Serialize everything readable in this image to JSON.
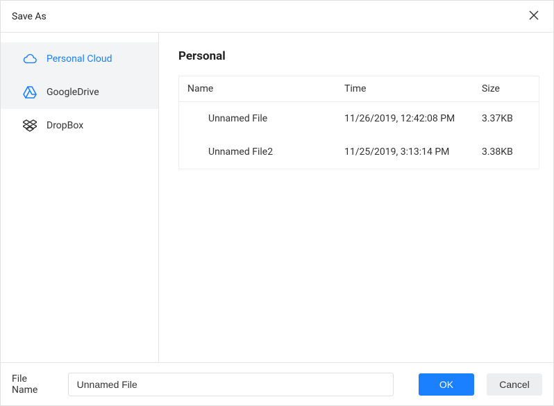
{
  "dialog": {
    "title": "Save As"
  },
  "sidebar": {
    "items": [
      {
        "label": "Personal Cloud",
        "icon": "cloud-icon",
        "active": true
      },
      {
        "label": "GoogleDrive",
        "icon": "google-drive-icon",
        "active": false
      },
      {
        "label": "DropBox",
        "icon": "dropbox-icon",
        "active": false
      }
    ]
  },
  "main": {
    "heading": "Personal",
    "columns": {
      "name": "Name",
      "time": "Time",
      "size": "Size"
    },
    "rows": [
      {
        "name": "Unnamed File",
        "time": "11/26/2019, 12:42:08 PM",
        "size": "3.37KB"
      },
      {
        "name": "Unnamed File2",
        "time": "11/25/2019, 3:13:14 PM",
        "size": "3.38KB"
      }
    ]
  },
  "footer": {
    "label": "File Name",
    "filename_value": "Unnamed File",
    "ok_label": "OK",
    "cancel_label": "Cancel"
  },
  "colors": {
    "accent": "#1a80ff"
  }
}
